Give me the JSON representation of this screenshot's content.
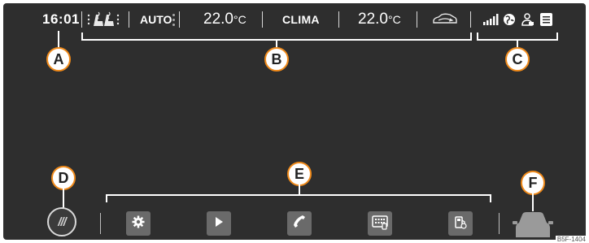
{
  "status_bar": {
    "time": "16:01",
    "auto_label": "AUTO",
    "temp_left_value": "22.0",
    "temp_left_unit": "°C",
    "clima_label": "CLIMA",
    "temp_right_value": "22.0",
    "temp_right_unit": "°C",
    "icons": [
      "seat-heating-icon",
      "recirculation-car-icon",
      "signal-strength-icon",
      "globe-icon",
      "user-profile-icon",
      "list-icon"
    ]
  },
  "callouts": {
    "a": "A",
    "b": "B",
    "c": "C",
    "d": "D",
    "e": "E",
    "f": "F"
  },
  "bottom_bar": {
    "menu_label": "///",
    "apps": [
      {
        "icon": "settings-gear-icon"
      },
      {
        "icon": "media-play-icon"
      },
      {
        "icon": "phone-icon"
      },
      {
        "icon": "smartphone-apps-icon"
      },
      {
        "icon": "fuel-pump-icon"
      }
    ],
    "vehicle_icon": "car-icon"
  },
  "figure_code": "B5F-1404",
  "colors": {
    "screen_bg": "#2e2e2e",
    "callout_border": "#f08a1a",
    "tile_bg": "#6a6a6a",
    "text": "#ffffff"
  }
}
